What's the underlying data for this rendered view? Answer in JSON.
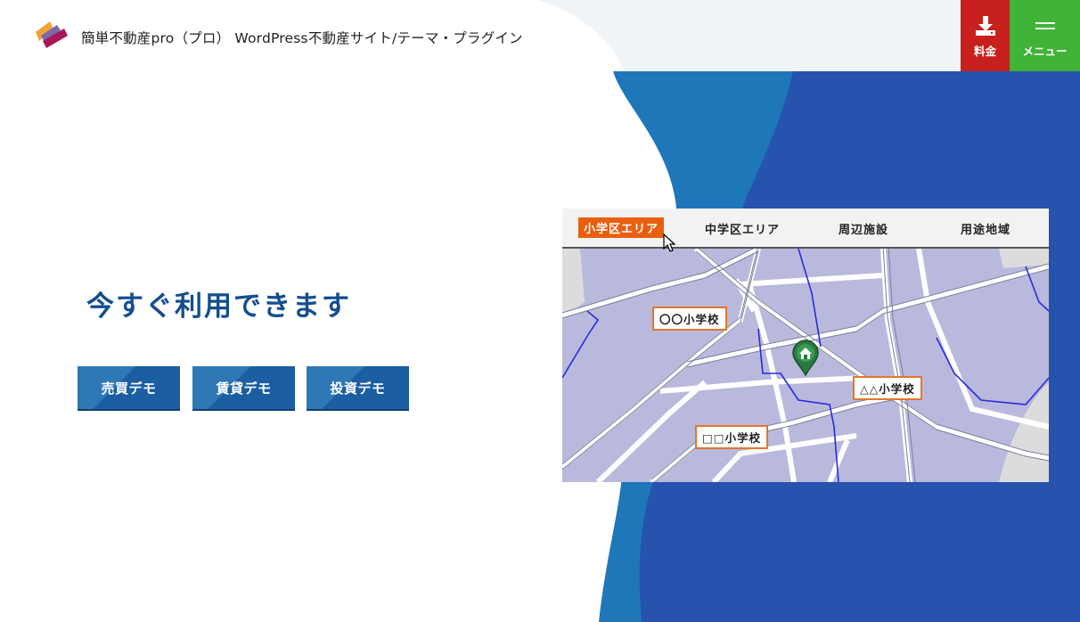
{
  "header": {
    "site_title": "簡単不動産pro（プロ） WordPress不動産サイト/テーマ・プラグイン",
    "price_label": "料金",
    "menu_label": "メニュー"
  },
  "hero": {
    "heading": "今すぐ利用できます",
    "buttons": [
      {
        "label": "売買デモ"
      },
      {
        "label": "賃貸デモ"
      },
      {
        "label": "投資デモ"
      }
    ]
  },
  "map": {
    "tabs": [
      {
        "label": "小学区エリア",
        "active": true
      },
      {
        "label": "中学区エリア",
        "active": false
      },
      {
        "label": "周辺施設",
        "active": false
      },
      {
        "label": "用途地域",
        "active": false
      }
    ],
    "schools": [
      {
        "label": "〇〇小学校"
      },
      {
        "label": "△△小学校"
      },
      {
        "label": "□□小学校"
      }
    ]
  },
  "colors": {
    "price_button": "#c8201c",
    "menu_button": "#40b338",
    "heading": "#134e8e",
    "active_tab": "#ea5f0e",
    "map_area": "#b9b9dd",
    "bg_blue": "#2553ae",
    "bg_light_blue": "#1e77b8"
  },
  "icons": {
    "logo": "logo-mark",
    "price": "download-icon",
    "menu": "hamburger-icon",
    "cursor": "mouse-cursor-icon",
    "pin": "home-pin-icon"
  }
}
